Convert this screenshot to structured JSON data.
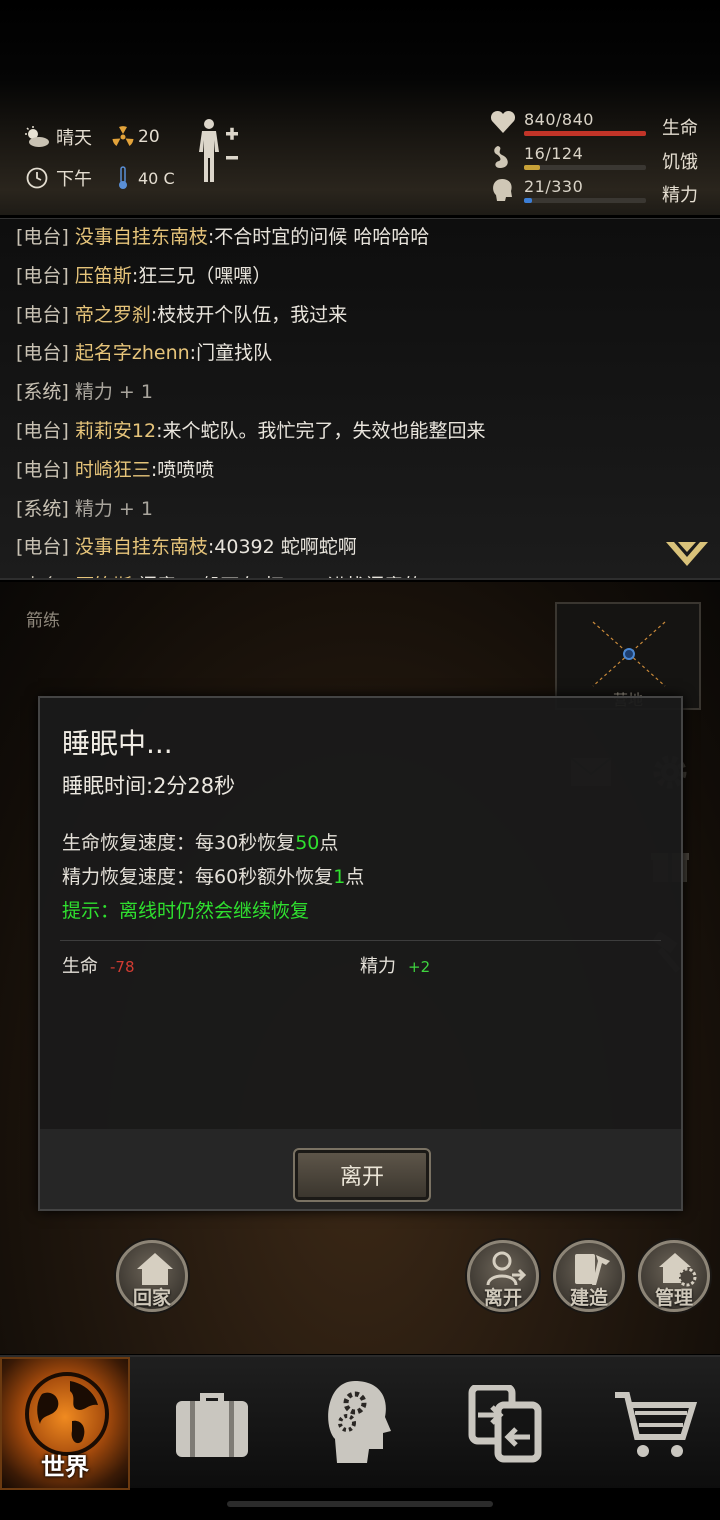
{
  "hud": {
    "weather": "晴天",
    "radiation": "20",
    "time_of_day": "下午",
    "temperature": "40 C",
    "stats": [
      {
        "name": "生命",
        "value": "840/840",
        "fill": 1.0,
        "color": "#c23428"
      },
      {
        "name": "饥饿",
        "value": "16/124",
        "fill": 0.13,
        "color": "#c8a238"
      },
      {
        "name": "精力",
        "value": "21/330",
        "fill": 0.064,
        "color": "#3c7ed6"
      }
    ]
  },
  "chat": {
    "lines": [
      {
        "tag": "[电台]",
        "name": "没事自挂东南枝",
        "msg": ":不合时宜的问候 哈哈哈哈"
      },
      {
        "tag": "[电台]",
        "name": "压笛斯",
        "msg": ":狂三兄（嘿嘿）"
      },
      {
        "tag": "[电台]",
        "name": "帝之罗刹",
        "msg": ":枝枝开个队伍，我过来"
      },
      {
        "tag": "[电台]",
        "name": "起名字zhenn",
        "msg": ":门童找队"
      },
      {
        "tag": "[系统]",
        "name": "",
        "msg": "精力 + 1"
      },
      {
        "tag": "[电台]",
        "name": "莉莉安12",
        "msg": ":来个蛇队。我忙完了，失效也能整回来"
      },
      {
        "tag": "[电台]",
        "name": "时崎狂三",
        "msg": ":喷喷喷"
      },
      {
        "tag": "[系统]",
        "name": "",
        "msg": "精力 + 1"
      },
      {
        "tag": "[电台]",
        "name": "没事自挂东南枝",
        "msg": ":40392 蛇啊蛇啊"
      },
      {
        "tag": "[电台]",
        "name": "压笛斯",
        "msg": ":门童 一般不在 打一一 进找门童的"
      }
    ]
  },
  "scene": {
    "location_label": "箭练",
    "minimap_label": "营地",
    "buttons": {
      "home": "回家",
      "leave": "离开",
      "build": "建造",
      "manage": "管理"
    }
  },
  "dialog": {
    "title": "睡眠中...",
    "sleep_time": "睡眠时间:2分28秒",
    "hp_regen_prefix": "生命恢复速度：每30秒恢复",
    "hp_regen_amount": "50",
    "hp_regen_suffix": "点",
    "energy_regen_prefix": "精力恢复速度：每60秒额外恢复",
    "energy_regen_amount": "1",
    "energy_regen_suffix": "点",
    "tip": "提示：离线时仍然会继续恢复",
    "hp_label": "生命",
    "hp_change": "-78",
    "energy_label": "精力",
    "energy_change": "+2",
    "leave_button": "离开"
  },
  "nav": {
    "world": "世界",
    "items": [
      "backpack-icon",
      "skills-head-icon",
      "trade-icon",
      "shop-cart-icon"
    ]
  }
}
